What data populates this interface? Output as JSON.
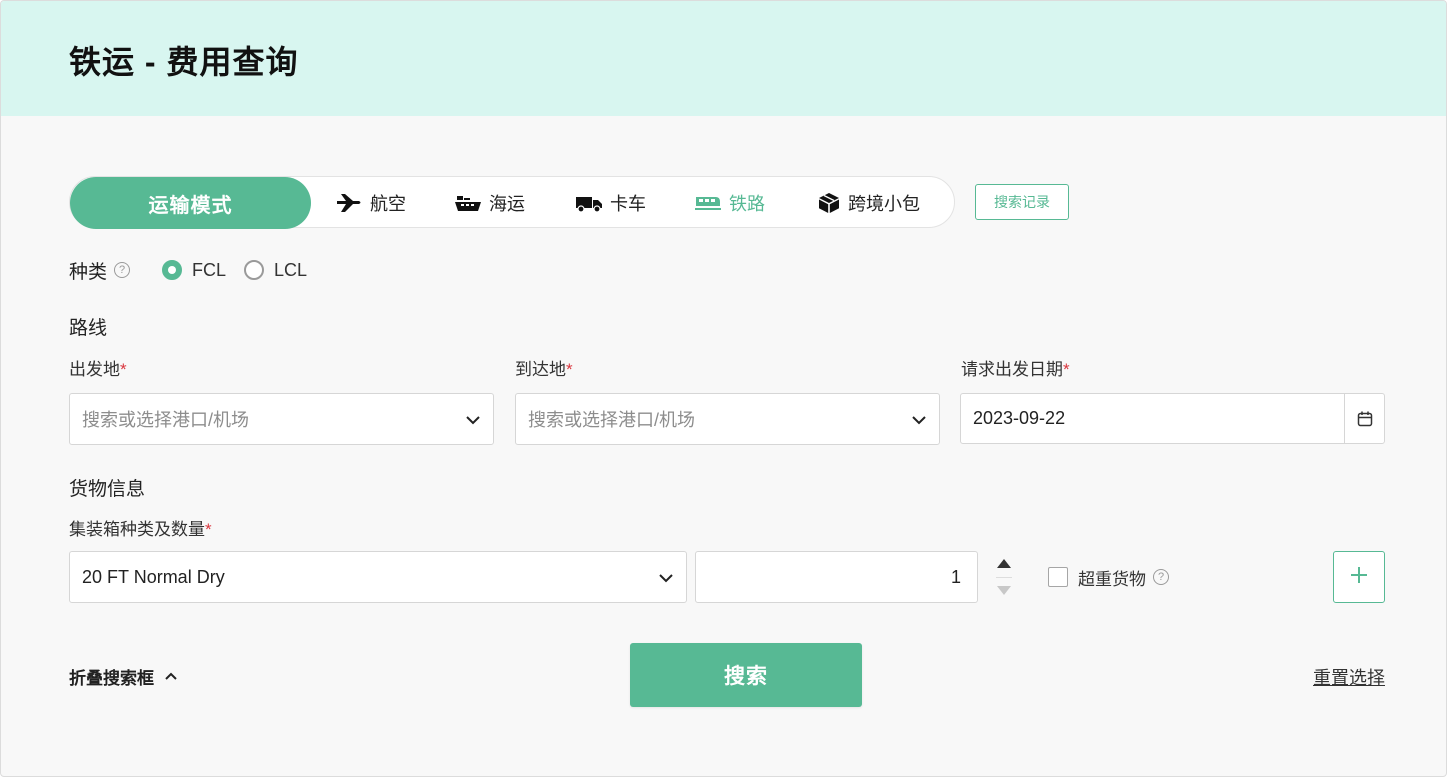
{
  "page_title": "铁运 - 费用查询",
  "transport": {
    "mode_label": "运输模式",
    "modes": [
      {
        "label": "航空",
        "icon": "plane-icon"
      },
      {
        "label": "海运",
        "icon": "ship-icon"
      },
      {
        "label": "卡车",
        "icon": "truck-icon"
      },
      {
        "label": "铁路",
        "icon": "train-icon",
        "active": true
      },
      {
        "label": "跨境小包",
        "icon": "package-icon"
      }
    ],
    "history_button": "搜索记录"
  },
  "category": {
    "label": "种类",
    "options": [
      {
        "label": "FCL",
        "selected": true
      },
      {
        "label": "LCL",
        "selected": false
      }
    ]
  },
  "route": {
    "title": "路线",
    "origin": {
      "label": "出发地",
      "placeholder": "搜索或选择港口/机场"
    },
    "destination": {
      "label": "到达地",
      "placeholder": "搜索或选择港口/机场"
    },
    "date": {
      "label": "请求出发日期",
      "value": "2023-09-22"
    }
  },
  "cargo": {
    "title": "货物信息",
    "container_label": "集装箱种类及数量",
    "container_type": "20 FT Normal Dry",
    "quantity": "1",
    "overweight_label": "超重货物"
  },
  "actions": {
    "collapse": "折叠搜索框",
    "search": "搜索",
    "reset": "重置选择"
  },
  "colors": {
    "accent": "#57b994",
    "header_bg": "#d8f6f0",
    "required": "#d9363e"
  }
}
